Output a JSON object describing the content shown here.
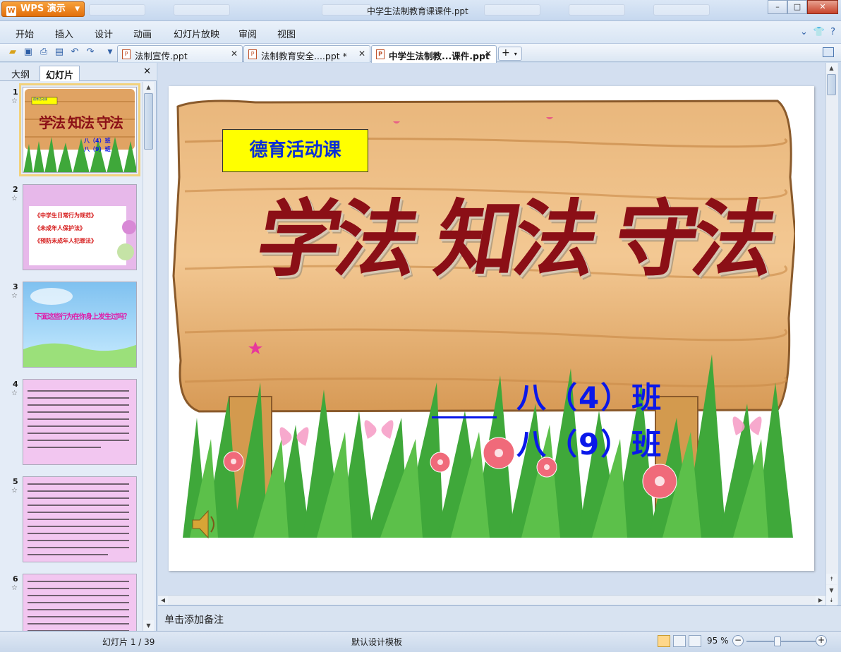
{
  "app": {
    "name": "WPS 演示",
    "window_title": "中学生法制教育课课件.ppt"
  },
  "window_controls": {
    "minimize": "–",
    "maximize": "□",
    "close": "✕"
  },
  "menu": [
    "开始",
    "插入",
    "设计",
    "动画",
    "幻灯片放映",
    "审阅",
    "视图"
  ],
  "doc_tabs": [
    {
      "label": "法制宣传.ppt",
      "active": false
    },
    {
      "label": "法制教育安全....ppt *",
      "active": false
    },
    {
      "label": "中学生法制教...课件.ppt",
      "active": true
    }
  ],
  "panel": {
    "tabs": [
      "大纲",
      "幻灯片"
    ],
    "active_tab": "幻灯片",
    "thumbnails": [
      {
        "num": "1",
        "title": "学法 知法 守法",
        "lines": [
          "八（4）班",
          "八（9）班"
        ],
        "badge": "德育活动课"
      },
      {
        "num": "2",
        "lines": [
          "《中学生日常行为规范》",
          "《未成年人保护法》",
          "《预防未成年人犯罪法》"
        ]
      },
      {
        "num": "3",
        "title": "下面这些行为在你身上发生过吗？"
      },
      {
        "num": "4"
      },
      {
        "num": "5"
      },
      {
        "num": "6"
      }
    ]
  },
  "slide": {
    "badge": "德育活动课",
    "title": "学法 知法 守法",
    "class_1": "八（4）班",
    "class_2": "八（9）班"
  },
  "notes_placeholder": "单击添加备注",
  "status": {
    "slide_info": "幻灯片 1 / 39",
    "template": "默认设计模板",
    "zoom": "95 %"
  },
  "colors": {
    "title_red": "#8b0f16",
    "class_blue": "#0a18ea",
    "badge_yellow": "#ffff00",
    "wps_orange": "#e26f0c"
  }
}
